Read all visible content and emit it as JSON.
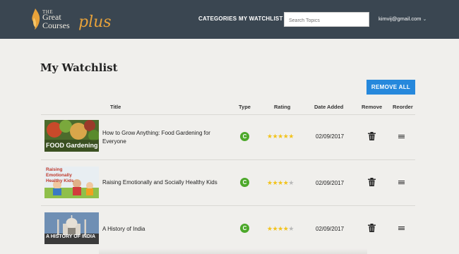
{
  "header": {
    "logo": {
      "line1": "THE",
      "line2": "Great",
      "line3": "Courses",
      "plus": "plus"
    },
    "nav": [
      {
        "label": "CATEGORIES"
      },
      {
        "label": "MY WATCHLIST"
      }
    ],
    "search": {
      "placeholder": "Search Topics",
      "value": ""
    },
    "user": {
      "email": "kimvij@gmail.com",
      "icon": "chevron-down-icon"
    }
  },
  "main": {
    "title": "My Watchlist",
    "remove_all_label": "REMOVE ALL",
    "accent_color": "#2688dc",
    "columns": [
      "Title",
      "Type",
      "Rating",
      "Date Added",
      "Remove",
      "Reorder"
    ],
    "courses": [
      {
        "title": "How to Grow Anything: Food Gardening for Everyone",
        "thumb_label": "FOOD Gardening",
        "type": "C",
        "rating": 5,
        "date_added": "02/09/2017"
      },
      {
        "title": "Raising Emotionally and Socially Healthy Kids",
        "thumb_label": "Raising Emotionally Healthy Kids",
        "type": "C",
        "rating": 4,
        "date_added": "02/09/2017"
      },
      {
        "title": "A History of India",
        "thumb_label": "A HISTORY OF INDIA",
        "type": "C",
        "rating": 4,
        "date_added": "02/09/2017"
      }
    ]
  }
}
